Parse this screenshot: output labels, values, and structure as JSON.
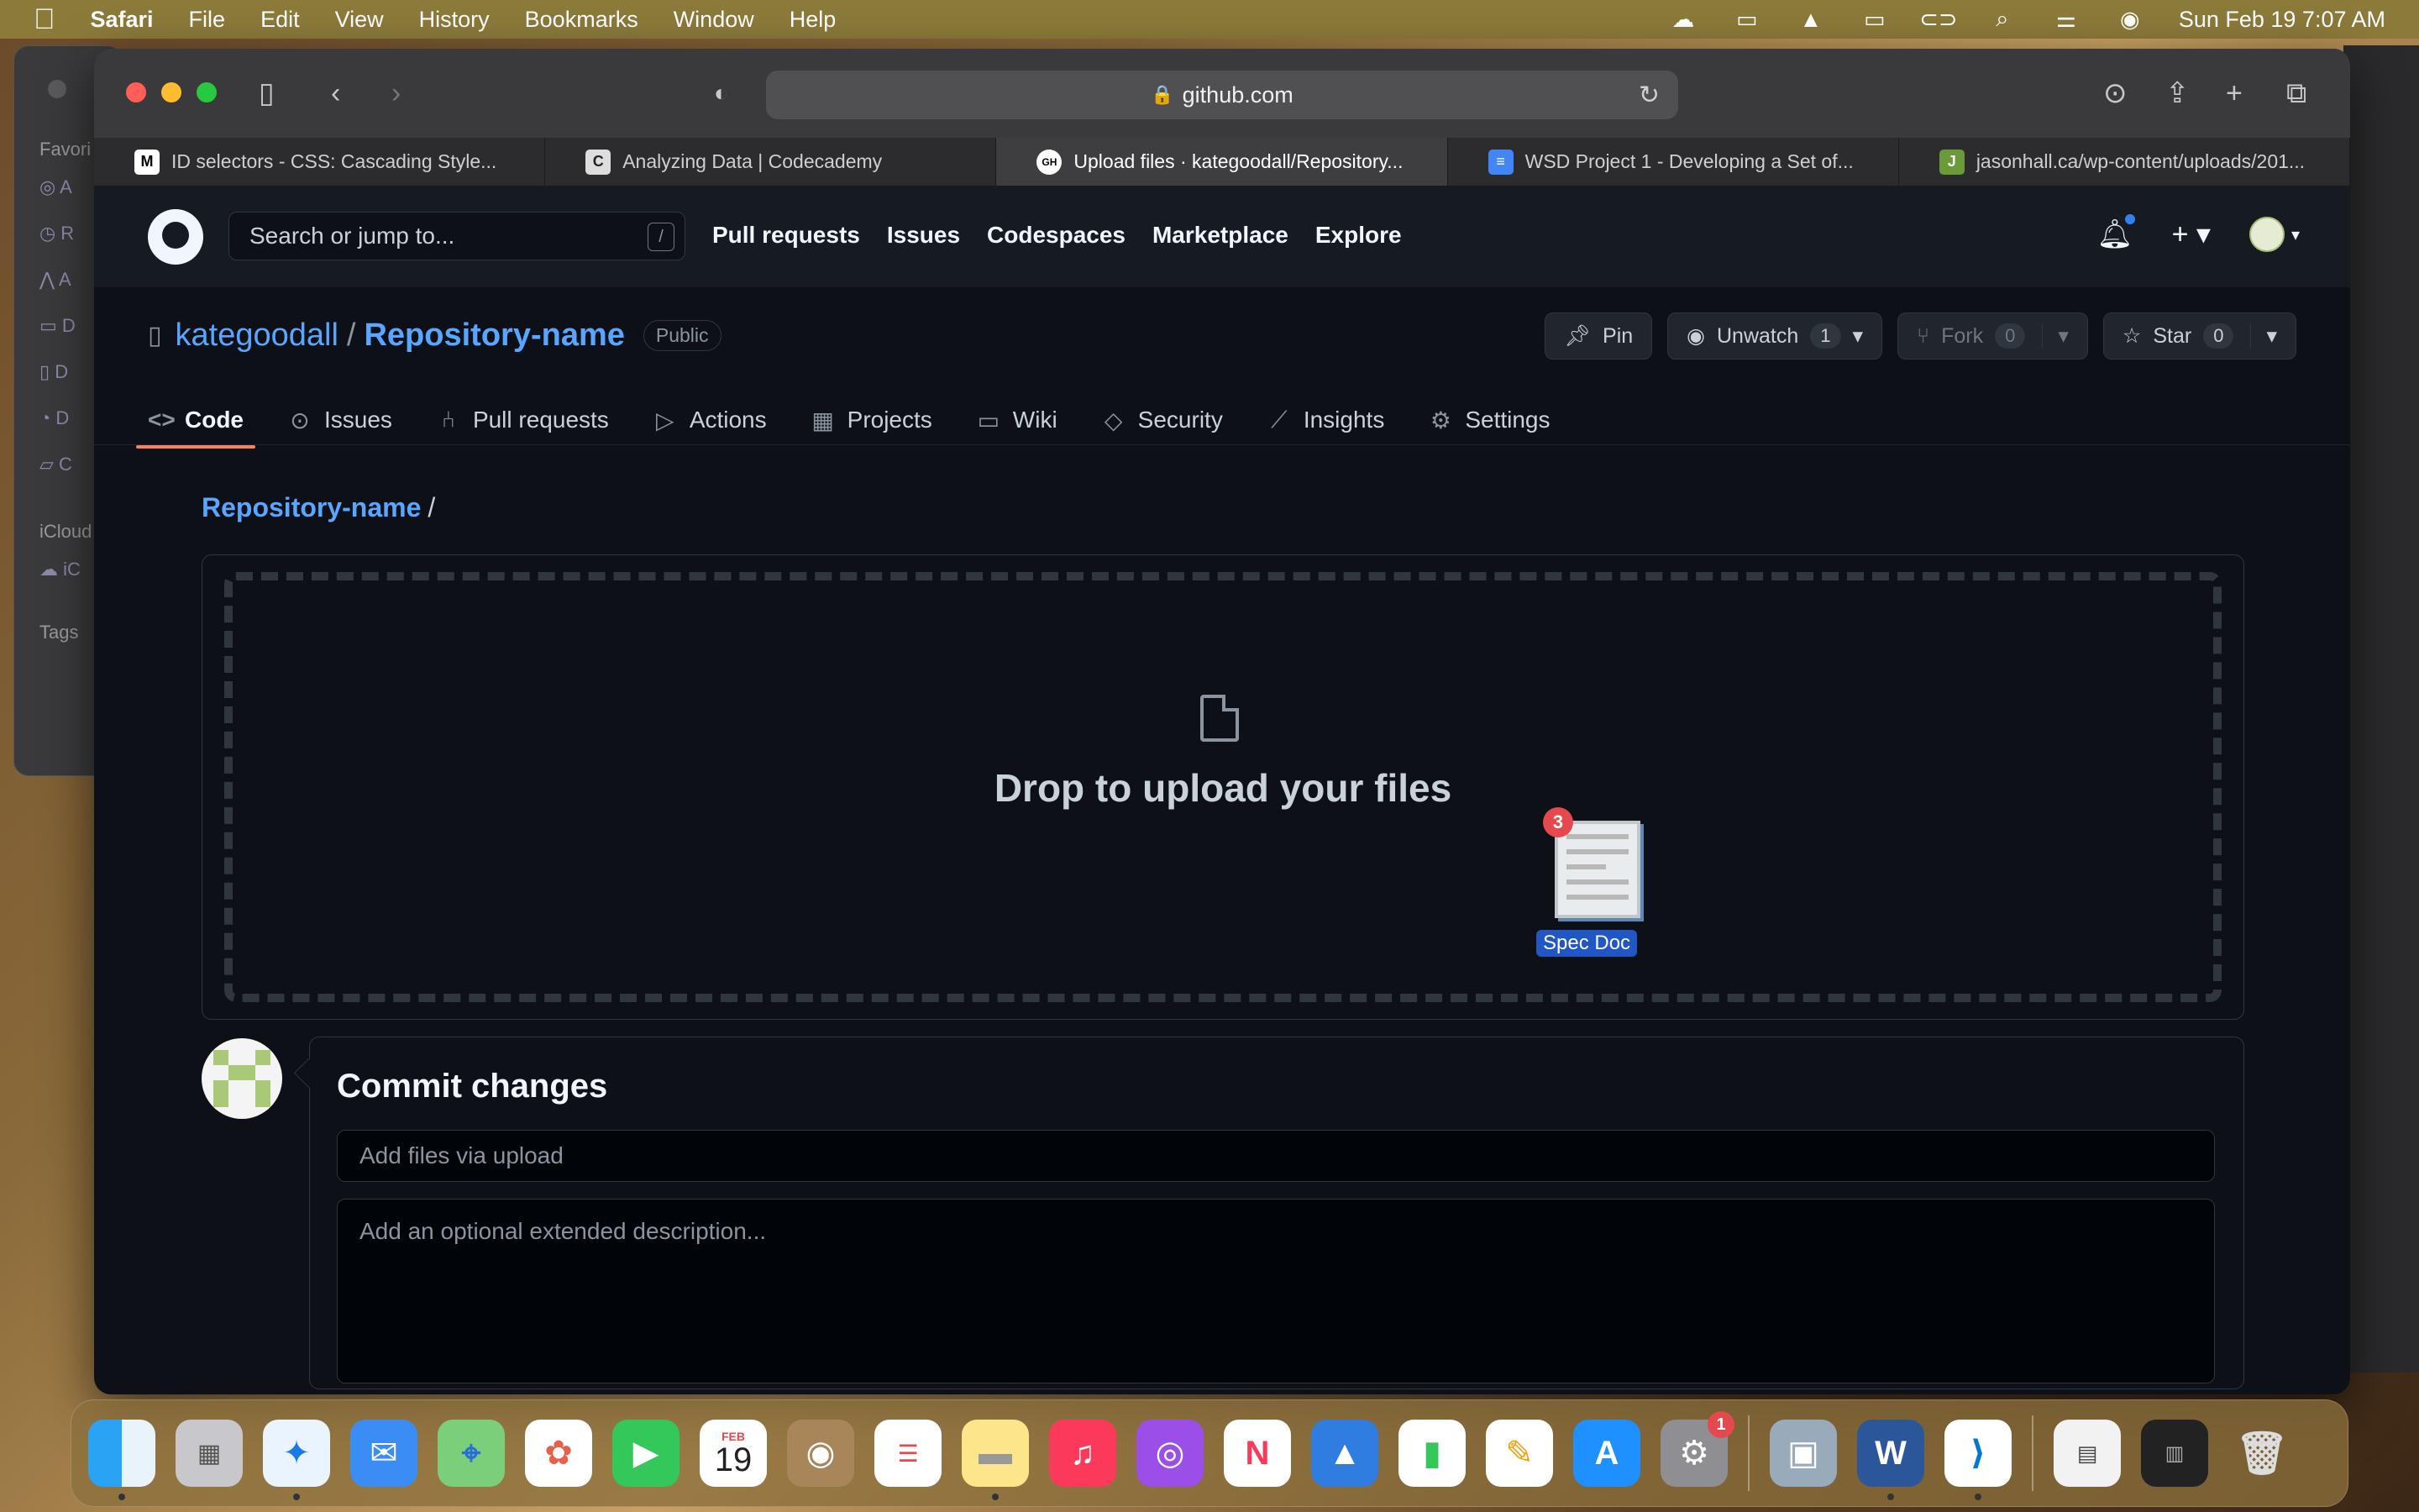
{
  "menubar": {
    "app": "Safari",
    "items": [
      "File",
      "Edit",
      "View",
      "History",
      "Bookmarks",
      "Window",
      "Help"
    ],
    "datetime": "Sun Feb 19  7:07 AM"
  },
  "finder": {
    "favorites": "Favori",
    "icloud": "iCloud",
    "tags": "Tags"
  },
  "browser": {
    "url": "github.com",
    "tabs": [
      {
        "title": "ID selectors - CSS: Cascading Style...",
        "favicon": "M"
      },
      {
        "title": "Analyzing Data | Codecademy",
        "favicon": "C"
      },
      {
        "title": "Upload files · kategoodall/Repository...",
        "favicon": "GH"
      },
      {
        "title": "WSD Project 1 - Developing a Set of...",
        "favicon": "≡"
      },
      {
        "title": "jasonhall.ca/wp-content/uploads/201...",
        "favicon": "J"
      }
    ]
  },
  "github": {
    "search_placeholder": "Search or jump to...",
    "search_shortcut": "/",
    "nav": [
      "Pull requests",
      "Issues",
      "Codespaces",
      "Marketplace",
      "Explore"
    ],
    "repo": {
      "owner": "kategoodall",
      "separator": "/",
      "name": "Repository-name",
      "visibility": "Public",
      "pin_label": "Pin",
      "watch_label": "Unwatch",
      "watch_count": "1",
      "fork_label": "Fork",
      "fork_count": "0",
      "star_label": "Star",
      "star_count": "0"
    },
    "repo_tabs": [
      "Code",
      "Issues",
      "Pull requests",
      "Actions",
      "Projects",
      "Wiki",
      "Security",
      "Insights",
      "Settings"
    ],
    "breadcrumb": {
      "link": "Repository-name",
      "slash": "/"
    },
    "dropzone": {
      "text": "Drop to upload your files",
      "drag_count": "3",
      "drag_label": "Spec Doc"
    },
    "commit": {
      "title": "Commit changes",
      "summary_placeholder": "Add files via upload",
      "description_placeholder": "Add an optional extended description..."
    }
  },
  "dock": {
    "calendar_month": "FEB",
    "calendar_day": "19",
    "settings_badge": "1"
  },
  "colors": {
    "accent": "#58a6ff",
    "tab_underline": "#f78166",
    "page_bg": "#0d1117",
    "header_bg": "#161b22"
  }
}
